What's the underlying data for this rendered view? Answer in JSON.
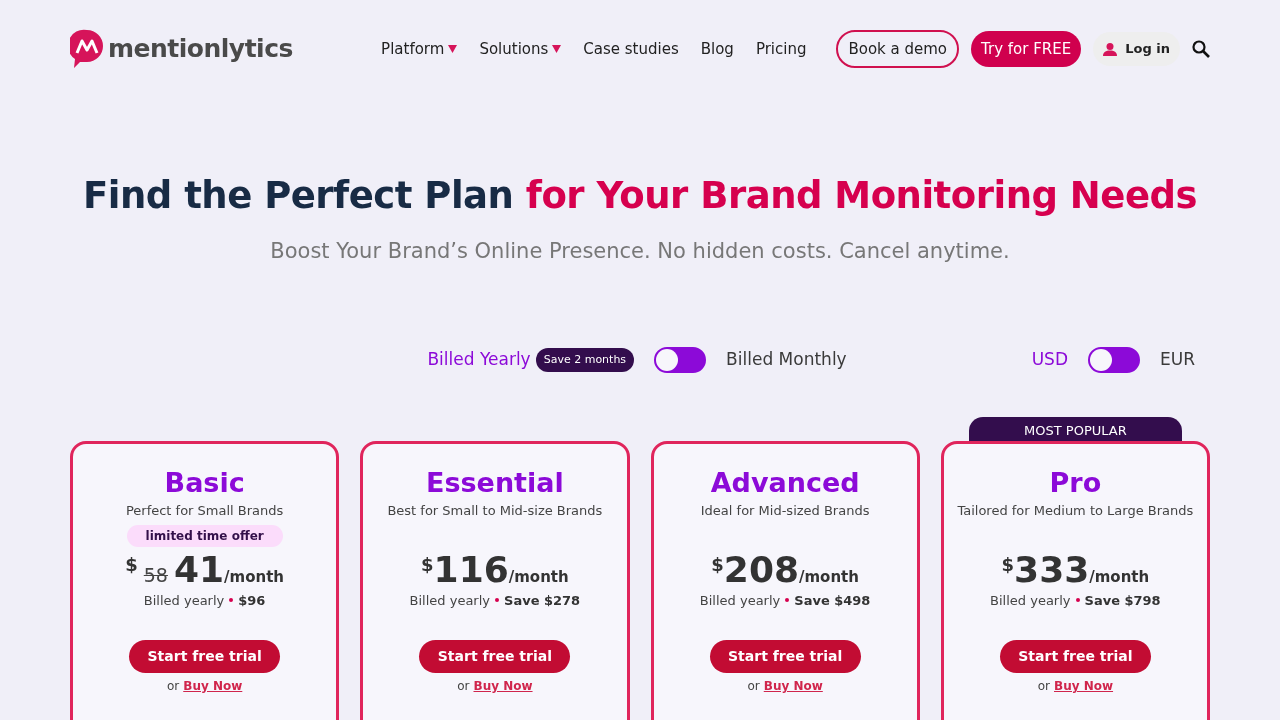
{
  "logo": {
    "text": "mentionlytics"
  },
  "nav": [
    {
      "label": "Platform",
      "dropdown": true
    },
    {
      "label": "Solutions",
      "dropdown": true
    },
    {
      "label": "Case studies",
      "dropdown": false
    },
    {
      "label": "Blog",
      "dropdown": false
    },
    {
      "label": "Pricing",
      "dropdown": false
    }
  ],
  "actions": {
    "demo": "Book a demo",
    "try": "Try for FREE",
    "login": "Log in"
  },
  "hero": {
    "title": "Find the Perfect Plan",
    "title_accent": "for Your Brand Monitoring Needs",
    "subtitle": "Boost Your Brand’s Online Presence. No hidden costs. Cancel anytime."
  },
  "billing": [
    {
      "label": "Billed Yearly",
      "badge": "Save 2 months",
      "selected": true
    },
    {
      "label": "Billed Monthly",
      "selected": false
    }
  ],
  "currency": [
    {
      "label": "USD",
      "selected": true
    },
    {
      "label": "EUR",
      "selected": false
    }
  ],
  "plans": [
    {
      "name": "Basic",
      "tagline": "Perfect for Small Brands",
      "offer": "limited time offer",
      "currency": "$",
      "old_price": "58",
      "price": "41",
      "period": "/month",
      "billed": "Billed yearly",
      "note": "$96",
      "cta": "Start free trial",
      "or": "or",
      "link": "Buy Now"
    },
    {
      "name": "Essential",
      "tagline": "Best for Small to Mid-size Brands",
      "currency": "$",
      "price": "116",
      "period": "/month",
      "billed": "Billed yearly",
      "note": "Save $278",
      "cta": "Start free trial",
      "or": "or",
      "link": "Buy Now"
    },
    {
      "name": "Advanced",
      "tagline": "Ideal for Mid-sized Brands",
      "currency": "$",
      "price": "208",
      "period": "/month",
      "billed": "Billed yearly",
      "note": "Save $498",
      "cta": "Start free trial",
      "or": "or",
      "link": "Buy Now"
    },
    {
      "name": "Pro",
      "tagline": "Tailored for Medium to Large Brands",
      "ribbon": "MOST POPULAR",
      "currency": "$",
      "price": "333",
      "period": "/month",
      "billed": "Billed yearly",
      "note": "Save $798",
      "cta": "Start free trial",
      "or": "or",
      "link": "Buy Now"
    }
  ]
}
